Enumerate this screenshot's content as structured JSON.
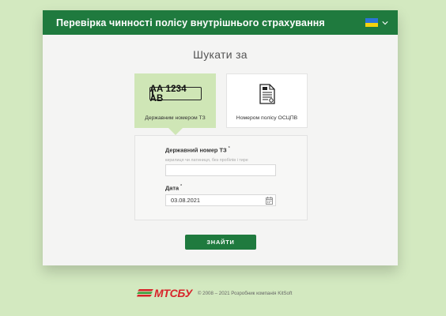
{
  "header": {
    "title": "Перевірка чинності полісу внутрішнього страхування",
    "lang_flag": "ukraine-flag-icon"
  },
  "search": {
    "title": "Шукати за",
    "options": [
      {
        "label": "Державним номером ТЗ",
        "plate": "AA 1234 AB",
        "selected": true
      },
      {
        "label": "Номером полісу ОСЦПВ",
        "selected": false
      }
    ]
  },
  "form": {
    "plate_label": "Державний номер ТЗ",
    "plate_required": "*",
    "plate_hint": "кирилиця чи латиниця, без пробілів і тире",
    "plate_value": "",
    "date_label": "Дата",
    "date_required": "*",
    "date_value": "03.08.2021"
  },
  "submit_label": "ЗНАЙТИ",
  "footer": {
    "logo": "МТСБУ",
    "copyright": "© 2008 – 2021 Розробник компанія KitSoft"
  },
  "colors": {
    "brand_green": "#1f7a3e",
    "selected_bg": "#cfe6b6",
    "page_bg": "#d3e9c0",
    "logo_red": "#d8232a"
  }
}
